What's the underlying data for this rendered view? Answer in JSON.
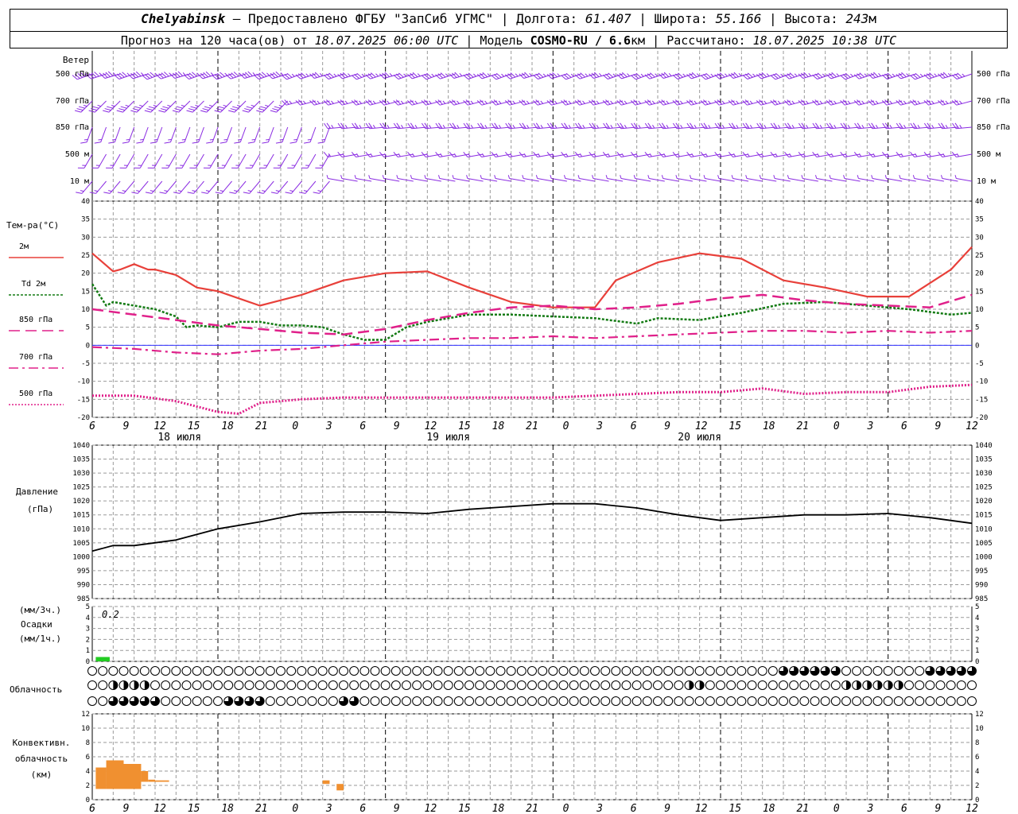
{
  "header": {
    "city": "Chelyabinsk",
    "provider": "Предоставлено ФГБУ \"ЗапСиб УГМС\"",
    "lon_label": "Долгота:",
    "lon": "61.407",
    "lat_label": "Широта:",
    "lat": "55.166",
    "alt_label": "Высота:",
    "alt": "243",
    "alt_unit": "м",
    "forecast_prefix": "Прогноз на 120 часа(ов)  от",
    "forecast_start": "18.07.2025 06:00 UTC",
    "model_label": "Модель",
    "model": "COSMO-RU / 6.6",
    "model_unit": "км",
    "calc_label": "Рассчитано:",
    "calc_time": "18.07.2025 10:38 UTC"
  },
  "colors": {
    "wind": "#8a2be2",
    "t2m": "#e8403a",
    "td2m": "#127a12",
    "t850": "#e0208a",
    "t700": "#e0208a",
    "t500": "#e0208a",
    "pressure": "#000000",
    "precip": "#22cc22",
    "convective": "#f09030",
    "grid": "#9a9a9a",
    "zero_line": "#3030ff"
  },
  "labels": {
    "wind_title": "Ветер",
    "wind_levels": [
      "500 гПа",
      "700 гПа",
      "850 гПа",
      "500 м",
      "10  м"
    ],
    "temp_title": "Тем-ра(°С)",
    "legend": [
      "2м",
      "Td  2м",
      "850 гПа",
      "700 гПа",
      "500 гПа"
    ],
    "pressure_title": "Давление",
    "pressure_unit": "(гПа)",
    "precip_unit_top": "(мм/3ч.)",
    "precip_title": "Осадки",
    "precip_unit_bottom": "(мм/1ч.)",
    "precip_note": "0.2",
    "cloud_title": "Облачность",
    "conv_title": [
      "Конвективн.",
      "облачность",
      "(км)"
    ],
    "days": [
      "18 июля",
      "19 июля",
      "20 июля"
    ],
    "hour_ticks": [
      "6",
      "9",
      "12",
      "15",
      "18",
      "21",
      "0",
      "3",
      "6",
      "9",
      "12",
      "15",
      "18",
      "21",
      "0",
      "3",
      "6",
      "9",
      "12",
      "15",
      "18",
      "21",
      "0",
      "3",
      "6",
      "9",
      "12"
    ]
  },
  "chart_data": [
    {
      "type": "line",
      "title": "Тем-ра(°С)",
      "x_unit": "hours from 18.07.2025 06:00 UTC",
      "ylim": [
        -20,
        40
      ],
      "yticks": [
        -20,
        -15,
        -10,
        -5,
        0,
        5,
        10,
        15,
        20,
        25,
        30,
        35,
        40
      ],
      "series": [
        {
          "name": "2м",
          "x": [
            0,
            3,
            4,
            6,
            8,
            9,
            12,
            15,
            18,
            24,
            30,
            36,
            42,
            48,
            54,
            60,
            66,
            72,
            75,
            81,
            87,
            93,
            99,
            105,
            111,
            117,
            123,
            126
          ],
          "y": [
            25.5,
            20.5,
            21,
            22.5,
            21,
            21,
            19.5,
            16,
            15,
            11,
            14,
            18,
            20,
            20.5,
            16,
            12,
            10.5,
            10.5,
            18,
            23,
            25.5,
            24,
            18,
            16,
            13.5,
            13.5,
            21,
            27.3
          ]
        },
        {
          "name": "Td  2м",
          "x": [
            0,
            2,
            3,
            6,
            9,
            12,
            13.5,
            15,
            18,
            21,
            24,
            27,
            30,
            33,
            36,
            39,
            42,
            45,
            48,
            54,
            60,
            66,
            72,
            78,
            81,
            87,
            93,
            99,
            105,
            111,
            117,
            123,
            126
          ],
          "y": [
            17,
            11,
            12,
            11,
            10,
            8,
            5,
            5.5,
            5,
            6.5,
            6.5,
            5.5,
            5.5,
            5,
            3,
            1.5,
            1.5,
            5,
            6.5,
            8.5,
            8.5,
            8,
            7.5,
            6,
            7.5,
            7,
            9,
            11.5,
            12,
            11,
            10,
            8.5,
            9
          ]
        },
        {
          "name": "850 гПа",
          "x": [
            0,
            6,
            12,
            18,
            24,
            30,
            36,
            42,
            48,
            54,
            60,
            66,
            72,
            78,
            84,
            90,
            96,
            102,
            108,
            114,
            120,
            126
          ],
          "y": [
            10,
            8.5,
            7,
            5.5,
            4.5,
            3.5,
            3,
            4.5,
            7,
            9,
            10.5,
            11,
            10,
            10.5,
            11.5,
            13,
            14,
            12.5,
            11.5,
            11,
            10.5,
            14
          ]
        },
        {
          "name": "700 гПа",
          "x": [
            0,
            6,
            12,
            18,
            24,
            30,
            36,
            42,
            48,
            54,
            60,
            66,
            72,
            78,
            84,
            90,
            96,
            102,
            108,
            114,
            120,
            126
          ],
          "y": [
            -0.5,
            -1,
            -2,
            -2.5,
            -1.5,
            -1,
            0,
            1,
            1.5,
            2,
            2,
            2.5,
            2,
            2.5,
            3,
            3.5,
            4,
            4,
            3.5,
            4,
            3.5,
            4
          ]
        },
        {
          "name": "500 гПа",
          "x": [
            0,
            6,
            12,
            18,
            21,
            24,
            30,
            36,
            42,
            48,
            54,
            60,
            66,
            72,
            78,
            84,
            90,
            96,
            102,
            108,
            114,
            120,
            126
          ],
          "y": [
            -14,
            -14,
            -15.5,
            -18.5,
            -19,
            -16,
            -15,
            -14.5,
            -14.5,
            -14.5,
            -14.5,
            -14.5,
            -14.5,
            -14,
            -13.5,
            -13,
            -13,
            -12,
            -13.5,
            -13,
            -13,
            -11.5,
            -11
          ]
        }
      ]
    },
    {
      "type": "line",
      "title": "Давление",
      "x_unit": "hours from 18.07.2025 06:00 UTC",
      "ylim": [
        985,
        1040
      ],
      "yticks": [
        985,
        990,
        995,
        1000,
        1005,
        1010,
        1015,
        1020,
        1025,
        1030,
        1035,
        1040
      ],
      "series": [
        {
          "name": "Давление",
          "x": [
            0,
            3,
            6,
            12,
            18,
            24,
            30,
            36,
            42,
            48,
            54,
            60,
            66,
            72,
            78,
            84,
            90,
            96,
            102,
            108,
            114,
            120,
            126
          ],
          "y": [
            1002,
            1004,
            1004,
            1006,
            1010,
            1012.5,
            1015.5,
            1016,
            1016,
            1015.5,
            1017,
            1018,
            1019,
            1019,
            1017.5,
            1015,
            1013,
            1014,
            1015,
            1015,
            1015.5,
            1014,
            1012
          ]
        }
      ]
    },
    {
      "type": "bar",
      "title": "Осадки",
      "x_unit": "hours from 18.07.2025 06:00 UTC",
      "ylim": [
        0,
        5
      ],
      "yticks": [
        0,
        1,
        2,
        3,
        4,
        5
      ],
      "series": [
        {
          "name": "мм/3ч",
          "x": [
            1.5
          ],
          "values": [
            0.2
          ]
        }
      ]
    },
    {
      "type": "bar",
      "title": "Конвективн. облачность (км)",
      "x_unit": "hours from 18.07.2025 06:00 UTC",
      "ylim": [
        0,
        12
      ],
      "yticks": [
        0,
        2,
        4,
        6,
        8,
        10,
        12
      ],
      "series": [
        {
          "name": "Конвективн. облачность",
          "bars": [
            {
              "x0": 0.5,
              "x1": 2,
              "bottom": 1.5,
              "top": 4.5
            },
            {
              "x0": 2,
              "x1": 4.5,
              "bottom": 1.5,
              "top": 5.5
            },
            {
              "x0": 4.5,
              "x1": 7,
              "bottom": 1.5,
              "top": 5
            },
            {
              "x0": 7,
              "x1": 8,
              "bottom": 2.5,
              "top": 4
            },
            {
              "x0": 8,
              "x1": 9,
              "bottom": 2.5,
              "top": 2.8
            },
            {
              "x0": 9,
              "x1": 11,
              "bottom": 2.5,
              "top": 2.7
            },
            {
              "x0": 33,
              "x1": 34,
              "bottom": 2.2,
              "top": 2.7
            },
            {
              "x0": 35,
              "x1": 36,
              "bottom": 1.3,
              "top": 2.2
            }
          ]
        }
      ]
    }
  ],
  "wind_rows": [
    {
      "level": "500 гПа",
      "speed": [
        20,
        20,
        22,
        22,
        22,
        22,
        25,
        25,
        25,
        25,
        25,
        25,
        25,
        25,
        25,
        25,
        25,
        25,
        25,
        25,
        25,
        25,
        28,
        28,
        28,
        28,
        28,
        28,
        28,
        28,
        28,
        28,
        28,
        28,
        28,
        28,
        28,
        28,
        28,
        28,
        28,
        28,
        25,
        25,
        25,
        25,
        25,
        25,
        25,
        25,
        25,
        25,
        25,
        25,
        25,
        25,
        25,
        25,
        25,
        25,
        25,
        25,
        25,
        25,
        25,
        25,
        25,
        25,
        25,
        25,
        25,
        25,
        25,
        25,
        25,
        25,
        25,
        25,
        25,
        25,
        25,
        25,
        25,
        25,
        25,
        25,
        25,
        25,
        25,
        25,
        25,
        25,
        25,
        25,
        25,
        25,
        25,
        25,
        25,
        25,
        25,
        25,
        25,
        25,
        25,
        25,
        25,
        25,
        25,
        25,
        25,
        25,
        25,
        25,
        25,
        25,
        25,
        25,
        25,
        25,
        25,
        25,
        25,
        25,
        25,
        25,
        25
      ]
    },
    {
      "level": "700 гПа",
      "speed": [
        15
      ]
    },
    {
      "level": "850 гПа",
      "speed": [
        10
      ]
    },
    {
      "level": "500 м",
      "speed": [
        10
      ]
    },
    {
      "level": "10  м",
      "speed": [
        5
      ]
    }
  ],
  "cloud_rows": [
    {
      "level": "upper",
      "cover": [
        0,
        0,
        0,
        0,
        0,
        0,
        0,
        0,
        0,
        0,
        0,
        0,
        0,
        0,
        0,
        0,
        0,
        0,
        0,
        0,
        0,
        0,
        0,
        0,
        0,
        0,
        0,
        0,
        0,
        0,
        0,
        0,
        0,
        0,
        0,
        0,
        0,
        0,
        0,
        0,
        0,
        0,
        0,
        0,
        0,
        0,
        0,
        0,
        0,
        0,
        0,
        0,
        0,
        0,
        0,
        0,
        0,
        0,
        0,
        0,
        0,
        0,
        0,
        0,
        0,
        0,
        0,
        0,
        0,
        0,
        0,
        0,
        0,
        0,
        0,
        0,
        0,
        0,
        0,
        0,
        0,
        0,
        0,
        0,
        0,
        0,
        0,
        0,
        0,
        0,
        0,
        0,
        0,
        0,
        0,
        0,
        0,
        0,
        0,
        0,
        0,
        0,
        0,
        0,
        0,
        0,
        0,
        0,
        0,
        0,
        0,
        0,
        0,
        0,
        0,
        0,
        0,
        0,
        0,
        0,
        0,
        0,
        0,
        0,
        0,
        0
      ]
    },
    {
      "level": "middle",
      "cover": [
        0
      ]
    },
    {
      "level": "lower",
      "cover": [
        0
      ]
    }
  ]
}
